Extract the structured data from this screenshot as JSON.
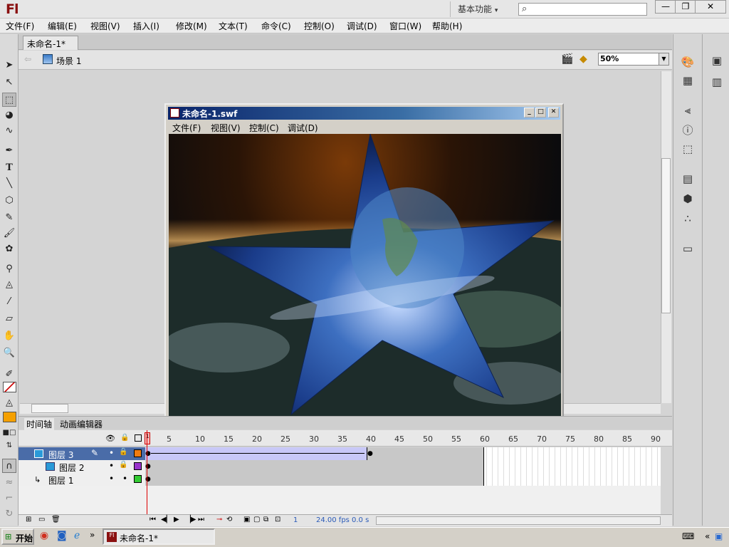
{
  "app": {
    "logo": "Fl",
    "workspace": "基本功能",
    "search_placeholder": ""
  },
  "window_controls": {
    "minimize": "—",
    "restore": "❐",
    "close": "✕"
  },
  "menu": [
    "文件(F)",
    "编辑(E)",
    "视图(V)",
    "插入(I)",
    "修改(M)",
    "文本(T)",
    "命令(C)",
    "控制(O)",
    "调试(D)",
    "窗口(W)",
    "帮助(H)"
  ],
  "document": {
    "tab": "未命名-1*",
    "tab_close": "×",
    "scene": "场景 1",
    "zoom": "50%"
  },
  "swf": {
    "title": "未命名-1.swf",
    "menu": [
      "文件(F)",
      "视图(V)",
      "控制(C)",
      "调试(D)"
    ]
  },
  "timeline": {
    "tabs": [
      "时间轴",
      "动画编辑器"
    ],
    "frame_numbers": [
      "5",
      "10",
      "15",
      "20",
      "25",
      "30",
      "35",
      "40",
      "45",
      "50",
      "55",
      "60",
      "65",
      "70",
      "75",
      "80",
      "85",
      "90"
    ],
    "current_frame_marker": "1",
    "layers": [
      {
        "name": "图层 3",
        "selected": true,
        "color": "#f07c10"
      },
      {
        "name": "图层 2",
        "selected": false,
        "color": "#9933cc"
      },
      {
        "name": "图层 1",
        "selected": false,
        "color": "#33cc33"
      }
    ],
    "status": {
      "frame": "1",
      "fps": "24.00 fps",
      "time": "0.0 s"
    }
  },
  "taskbar": {
    "start": "开始",
    "item": "未命名-1*"
  },
  "colors": {
    "stroke": "#cc0000",
    "fill": "#f5a000"
  }
}
